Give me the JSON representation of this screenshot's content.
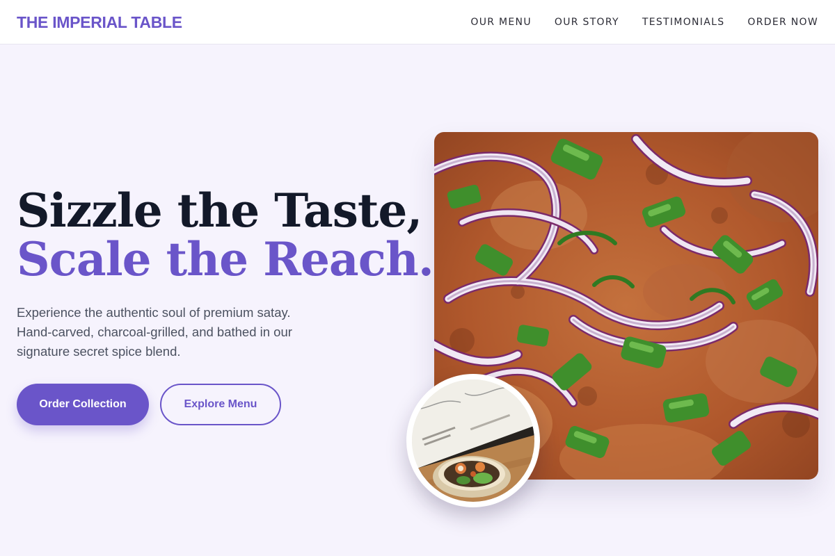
{
  "header": {
    "logo": "THE IMPERIAL TABLE",
    "nav": [
      "OUR MENU",
      "OUR STORY",
      "TESTIMONIALS",
      "ORDER NOW"
    ]
  },
  "hero": {
    "title_line1": "Sizzle the Taste,",
    "title_line2": "Scale the Reach.",
    "description": "Experience the authentic soul of premium satay. Hand-carved, charcoal-grilled, and bathed in our signature secret spice blend.",
    "primary_button": "Order Collection",
    "secondary_button": "Explore Menu"
  },
  "colors": {
    "accent": "#6a55c9",
    "background": "#f6f3fd",
    "heading_dark": "#131929",
    "body_text": "#4b5160"
  }
}
